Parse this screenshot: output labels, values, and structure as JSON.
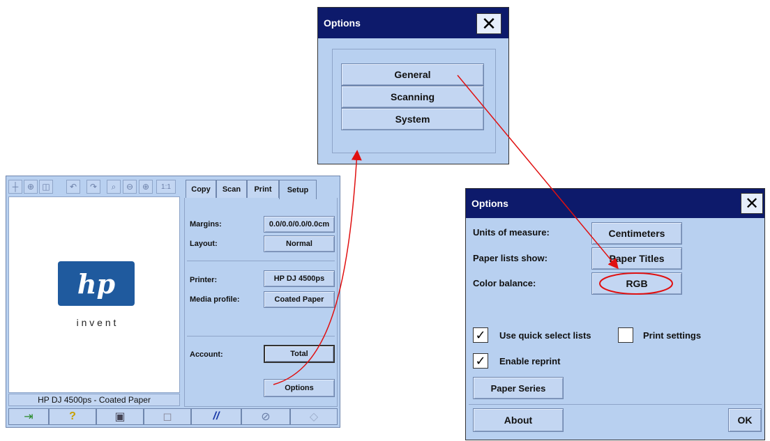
{
  "top_dialog": {
    "title": "Options",
    "buttons": [
      "General",
      "Scanning",
      "System"
    ]
  },
  "main_window": {
    "toolbar_icons": [
      "pan-icon",
      "crop-icon",
      "page-icon",
      "undo-icon",
      "redo-icon",
      "zoom-fit-icon",
      "zoom-out-icon",
      "zoom-in-icon",
      "one-to-one-icon"
    ],
    "toolbar_one_to_one": "1:1",
    "tabs": [
      "Copy",
      "Scan",
      "Print",
      "Setup"
    ],
    "logo_text": "hp",
    "logo_tagline": "i n v e n t",
    "status_text": "HP DJ 4500ps - Coated Paper",
    "settings": {
      "margins_label": "Margins:",
      "margins_value": "0.0/0.0/0.0/0.0cm",
      "layout_label": "Layout:",
      "layout_value": "Normal",
      "printer_label": "Printer:",
      "printer_value": "HP DJ 4500ps",
      "media_label": "Media profile:",
      "media_value": "Coated Paper",
      "account_label": "Account:",
      "account_value": "Total",
      "options_button": "Options"
    },
    "bottom_icons": [
      "exit-icon",
      "help-icon",
      "copy-icon",
      "preview-icon",
      "clear-icon",
      "stop-icon",
      "start-icon"
    ],
    "bottom_glyphs": [
      "⇥",
      "?",
      "▣",
      "◻",
      "//",
      "⊘",
      "◇"
    ]
  },
  "right_dialog": {
    "title": "Options",
    "units_label": "Units of measure:",
    "units_value": "Centimeters",
    "paper_lists_label": "Paper lists show:",
    "paper_lists_value": "Paper Titles",
    "color_balance_label": "Color balance:",
    "color_balance_value": "RGB",
    "quick_select_label": "Use quick select lists",
    "quick_select_checked": true,
    "print_settings_label": "Print settings",
    "print_settings_checked": false,
    "enable_reprint_label": "Enable reprint",
    "enable_reprint_checked": true,
    "paper_series_button": "Paper Series",
    "about_button": "About",
    "ok_button": "OK"
  },
  "colors": {
    "titlebar": "#0d1a6b",
    "panel": "#b8d0f0",
    "annotation": "#e01010",
    "hp_blue": "#1f5a9e"
  }
}
